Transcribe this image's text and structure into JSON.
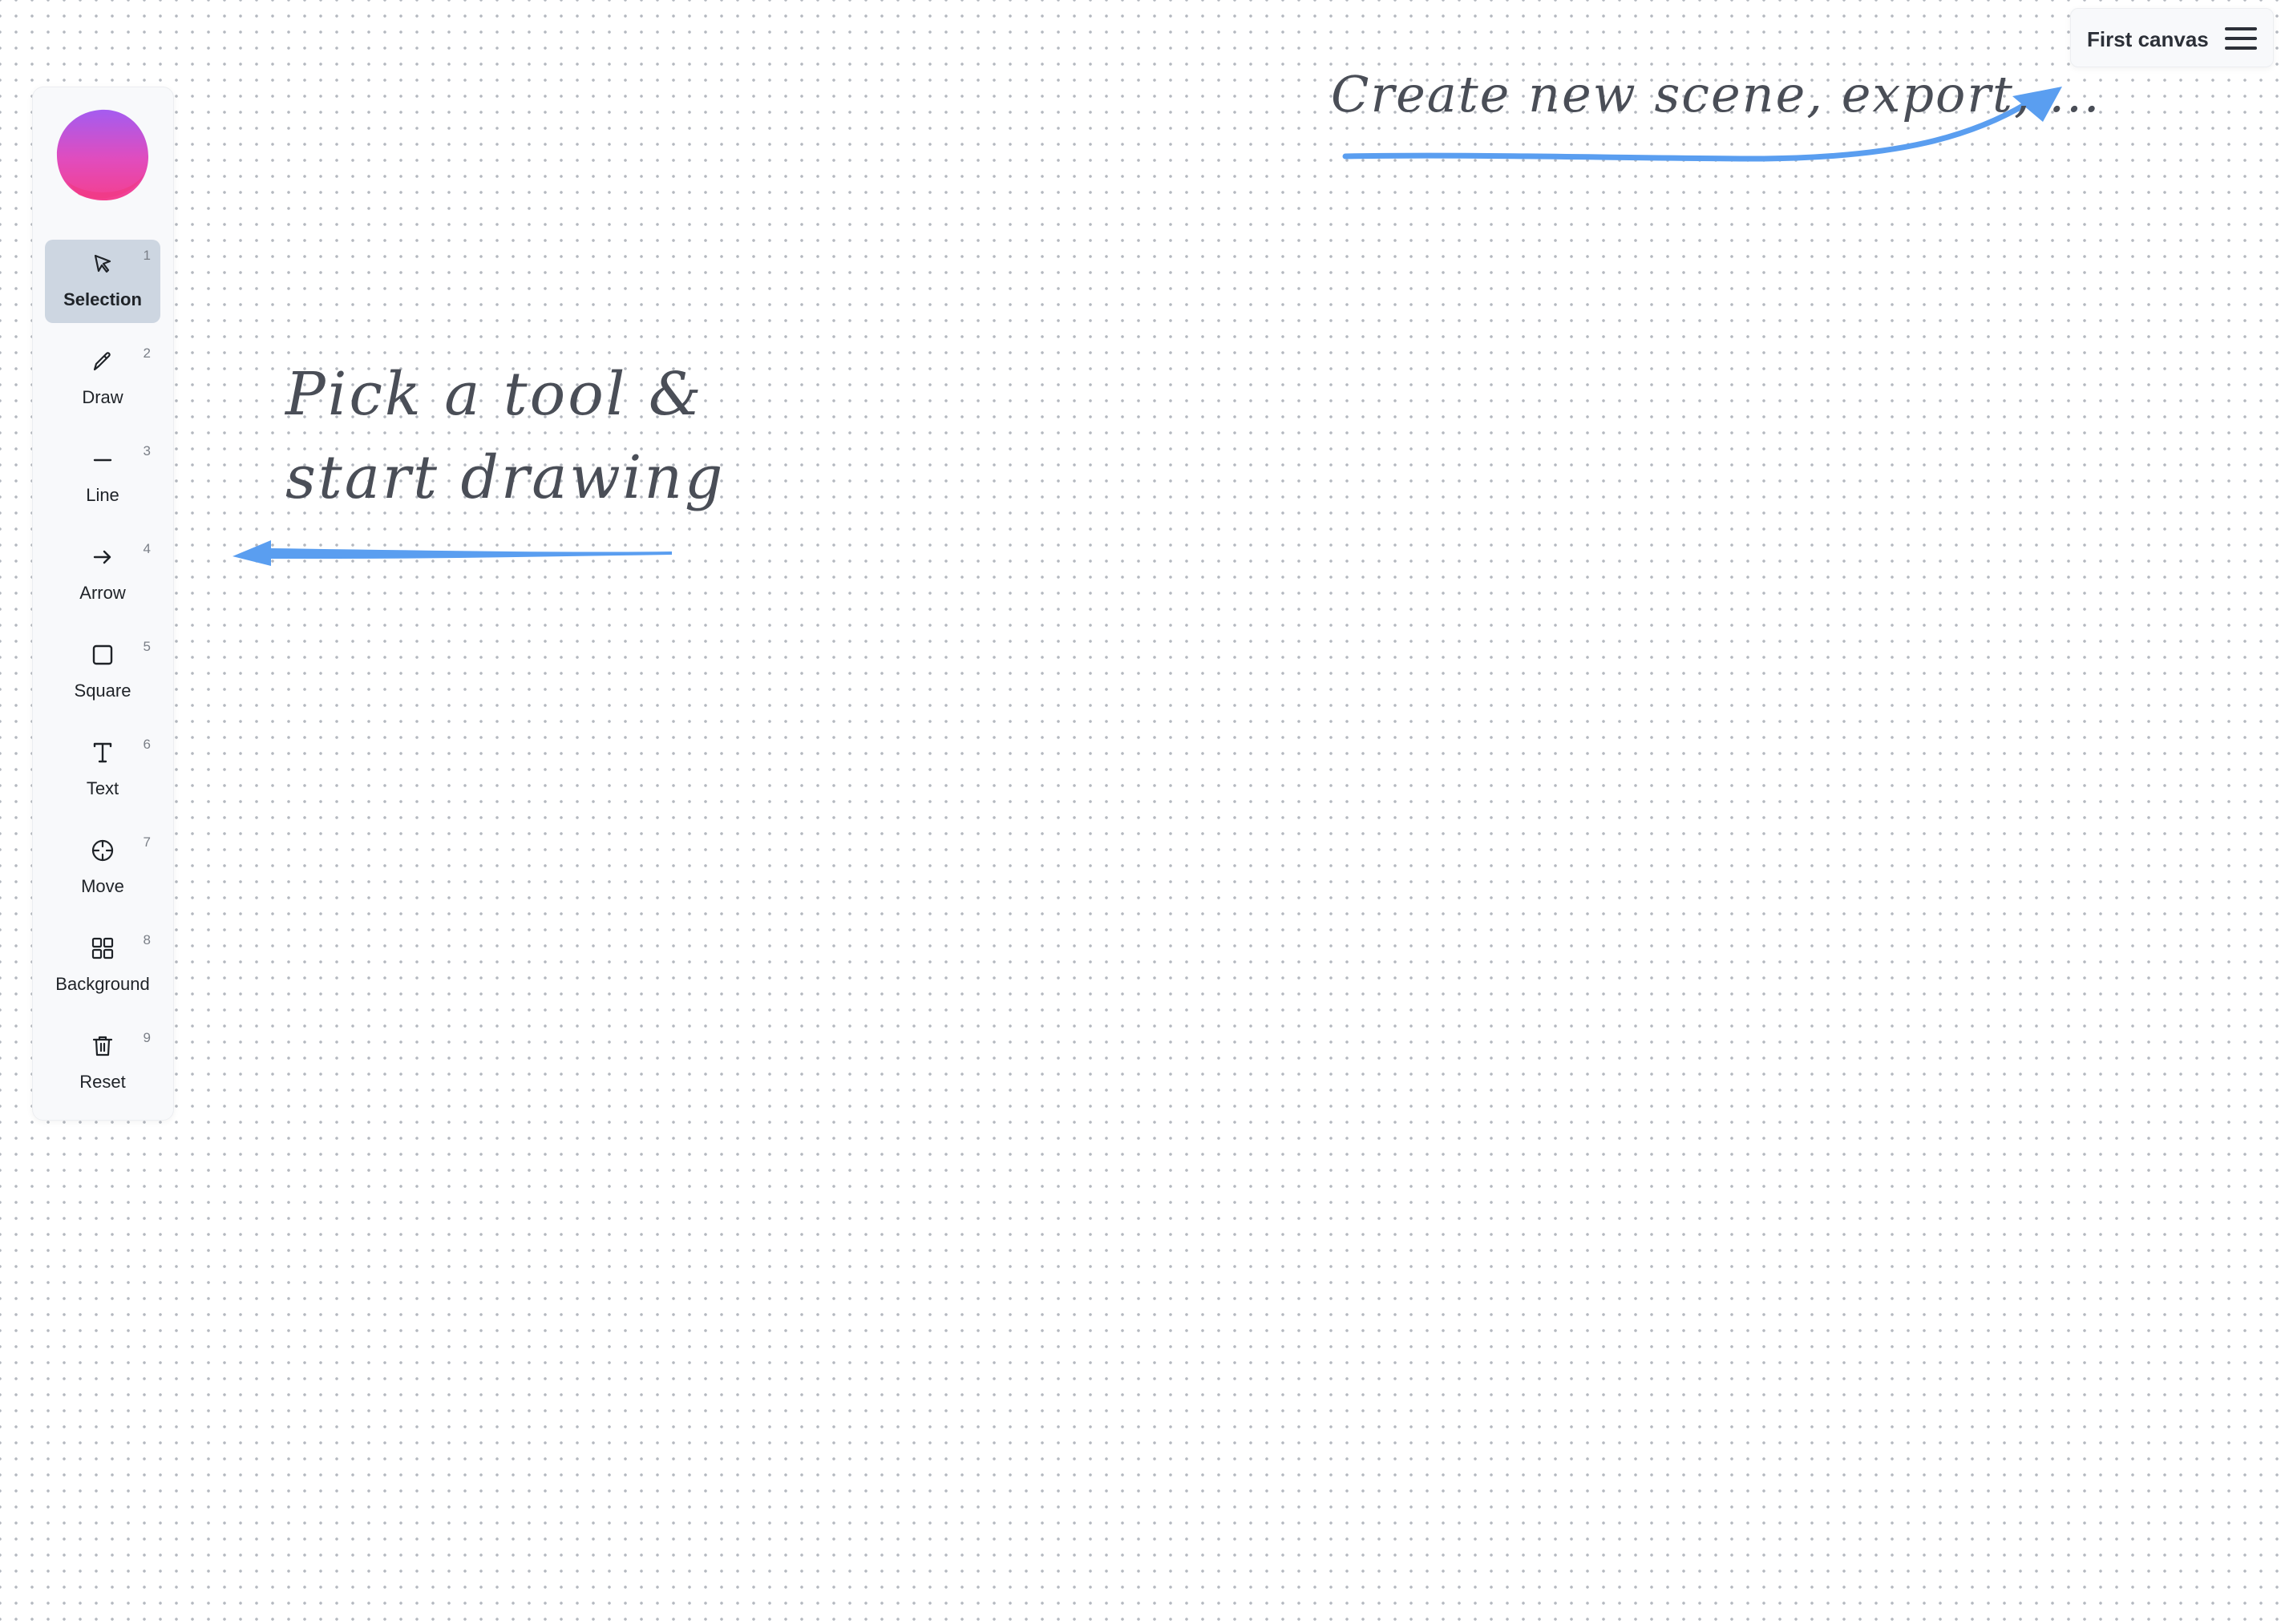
{
  "colors": {
    "accent_arrow": "#5a9ef0",
    "active_tool_bg": "#cdd6e1",
    "logo_gradient_top": "#a45cf0",
    "logo_gradient_bottom": "#f43f8e",
    "hint_text": "#4a4e57"
  },
  "header": {
    "canvas_name": "First canvas",
    "menu_icon": "hamburger-icon"
  },
  "toolbar": {
    "logo_icon": "blob-logo",
    "active_tool": "Selection",
    "tools": [
      {
        "label": "Selection",
        "key": "1",
        "icon": "cursor-icon"
      },
      {
        "label": "Draw",
        "key": "2",
        "icon": "pencil-icon"
      },
      {
        "label": "Line",
        "key": "3",
        "icon": "line-icon"
      },
      {
        "label": "Arrow",
        "key": "4",
        "icon": "arrow-right-icon"
      },
      {
        "label": "Square",
        "key": "5",
        "icon": "square-icon"
      },
      {
        "label": "Text",
        "key": "6",
        "icon": "text-icon"
      },
      {
        "label": "Move",
        "key": "7",
        "icon": "crosshair-icon"
      },
      {
        "label": "Background",
        "key": "8",
        "icon": "grid-icon"
      },
      {
        "label": "Reset",
        "key": "9",
        "icon": "trash-icon"
      }
    ]
  },
  "hints": {
    "pick_tool_line1": "Pick a tool &",
    "pick_tool_line2": "start drawing",
    "create_scene": "Create new scene, export, ..."
  }
}
